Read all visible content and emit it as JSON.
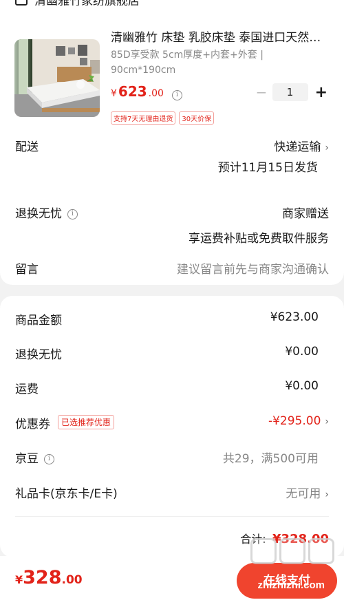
{
  "shop": {
    "name": "清幽雅竹家纺旗舰店"
  },
  "product": {
    "title": "清幽雅竹 床垫 乳胶床垫 泰国进口天然乳胶",
    "spec": "85D享受款 5cm厚度+内套+外套 | 90cm*190cm",
    "price_symbol": "¥",
    "price_int": "623",
    "price_dec": ".00",
    "quantity": "1",
    "minus_label": "−",
    "plus_label": "+",
    "tags": [
      "支持7天无理由退货",
      "30天价保"
    ]
  },
  "delivery": {
    "label": "配送",
    "method": "快递运输",
    "estimate": "预计11月15日发货"
  },
  "return_care": {
    "label": "退换无忧",
    "value": "商家赠送",
    "desc": "享运费补贴或免费取件服务"
  },
  "message": {
    "label": "留言",
    "placeholder": "建议留言前先与商家沟通确认"
  },
  "summary": {
    "goods_amount": {
      "label": "商品金额",
      "value": "¥623.00"
    },
    "return_care": {
      "label": "退换无忧",
      "value": "¥0.00"
    },
    "shipping": {
      "label": "运费",
      "value": "¥0.00"
    },
    "coupon": {
      "label": "优惠券",
      "tag": "已选推荐优惠",
      "value": "-¥295.00"
    },
    "jingdou": {
      "label": "京豆",
      "value": "共29，满500可用"
    },
    "giftcard": {
      "label": "礼品卡(京东卡/E卡)",
      "value": "无可用"
    },
    "total_label": "合计:",
    "total_value": "¥328.00"
  },
  "bottom": {
    "price_symbol": "¥",
    "price_int": "328",
    "price_dec": ".00",
    "pay_label": "在线支付"
  },
  "watermark": {
    "text": "zhizhizhi.com"
  },
  "colors": {
    "accent": "#e2231a",
    "pay_button": "#f0442e"
  }
}
